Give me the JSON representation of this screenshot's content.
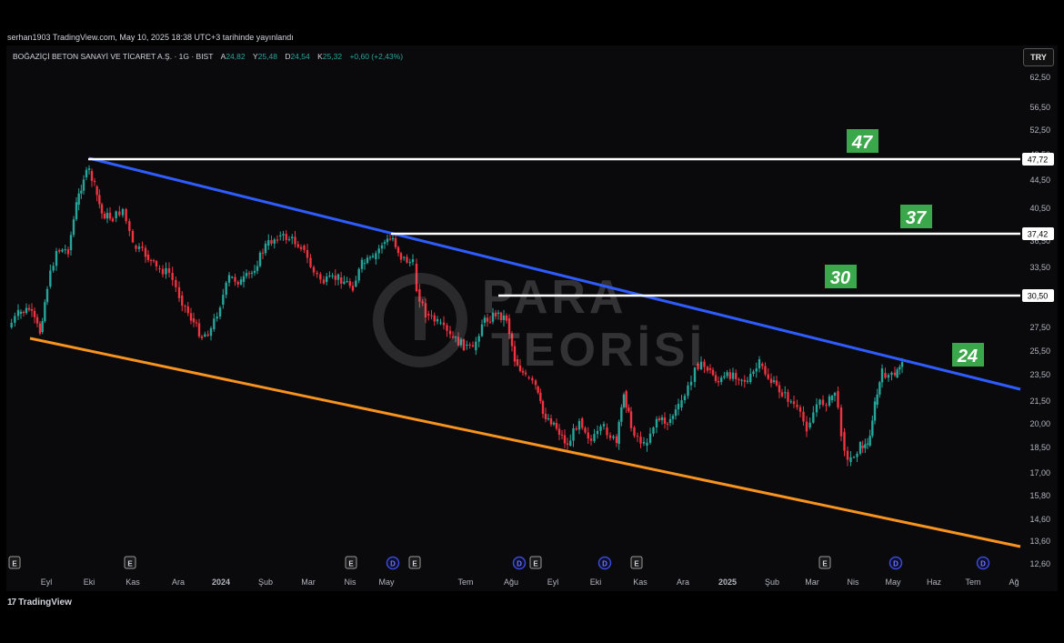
{
  "header": {
    "published": "serhan1903 TradingView.com, May 10, 2025 18:38 UTC+3 tarihinde yayınlandı"
  },
  "symbol": {
    "name": "BOĞAZİÇİ BETON SANAYİ VE TİCARET A.Ş. · 1G · BIST",
    "open_label": "A",
    "open": "24,82",
    "high_label": "Y",
    "high": "25,48",
    "low_label": "D",
    "low": "24,54",
    "close_label": "K",
    "close": "25,32",
    "change": "+0,60 (+2,43%)"
  },
  "currency": "TRY",
  "price_axis": [
    "62,50",
    "56,50",
    "52,50",
    "48,50",
    "44,50",
    "40,50",
    "36,50",
    "33,50",
    "30,50",
    "27,50",
    "25,50",
    "23,50",
    "21,50",
    "20,00",
    "18,50",
    "17,00",
    "15,80",
    "14,60",
    "13,60",
    "12,60"
  ],
  "time_axis": [
    "Eyl",
    "Eki",
    "Kas",
    "Ara",
    "2024",
    "Şub",
    "Mar",
    "Nis",
    "May",
    "Tem",
    "Ağu",
    "Eyl",
    "Eki",
    "Kas",
    "Ara",
    "2025",
    "Şub",
    "Mar",
    "Nis",
    "May",
    "Haz",
    "Tem",
    "Ağ"
  ],
  "event_markers": [
    "E",
    "E",
    "E",
    "D",
    "E",
    "D",
    "E",
    "D",
    "E",
    "E",
    "D",
    "D"
  ],
  "levels": [
    {
      "price": "47,72",
      "label": "47"
    },
    {
      "price": "37,42",
      "label": "37"
    },
    {
      "price": "30,50",
      "label": "30"
    }
  ],
  "trend_label": "24",
  "watermark": {
    "line1": "PARA",
    "line2": "TEORİSİ"
  },
  "footer": {
    "brand": "TradingView"
  },
  "colors": {
    "up": "#26a69a",
    "down": "#ef3340",
    "resistance": "#2f5cff",
    "support": "#f7931e",
    "level": "#ffffff",
    "badge": "#3aa74a"
  }
}
